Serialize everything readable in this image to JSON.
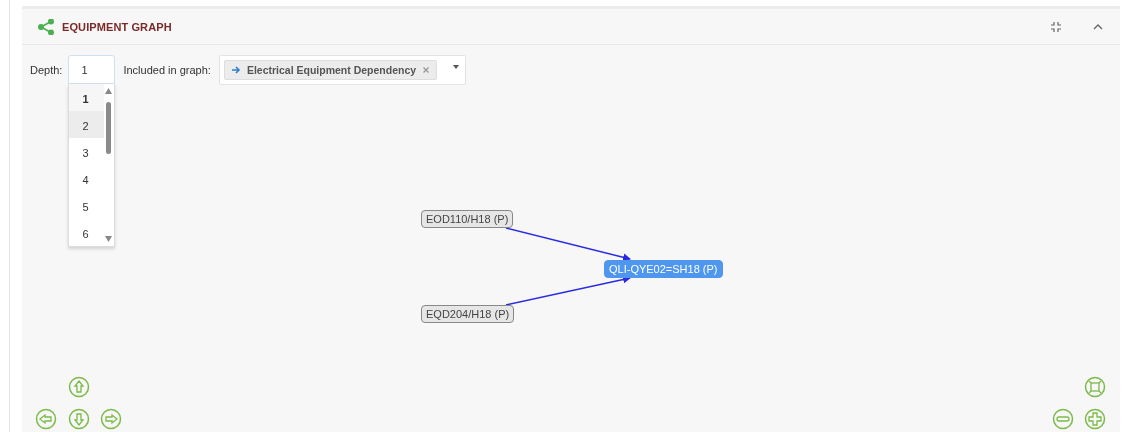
{
  "panel": {
    "title": "EQUIPMENT GRAPH"
  },
  "controls": {
    "depth_label": "Depth:",
    "depth_value": "1",
    "depth_options": [
      {
        "label": "1",
        "selected": true,
        "hovered": false
      },
      {
        "label": "2",
        "selected": false,
        "hovered": true
      },
      {
        "label": "3",
        "selected": false,
        "hovered": false
      },
      {
        "label": "4",
        "selected": false,
        "hovered": false
      },
      {
        "label": "5",
        "selected": false,
        "hovered": false
      },
      {
        "label": "6",
        "selected": false,
        "hovered": false
      }
    ],
    "included_label": "Included in graph:",
    "included_tags": [
      "Electrical Equipment Dependency"
    ]
  },
  "graph": {
    "nodes": [
      {
        "label": "EOD110/H18 (P)",
        "kind": "source"
      },
      {
        "label": "QLI-QYE02=SH18 (P)",
        "kind": "focus"
      },
      {
        "label": "EQD204/H18 (P)",
        "kind": "source"
      }
    ]
  }
}
